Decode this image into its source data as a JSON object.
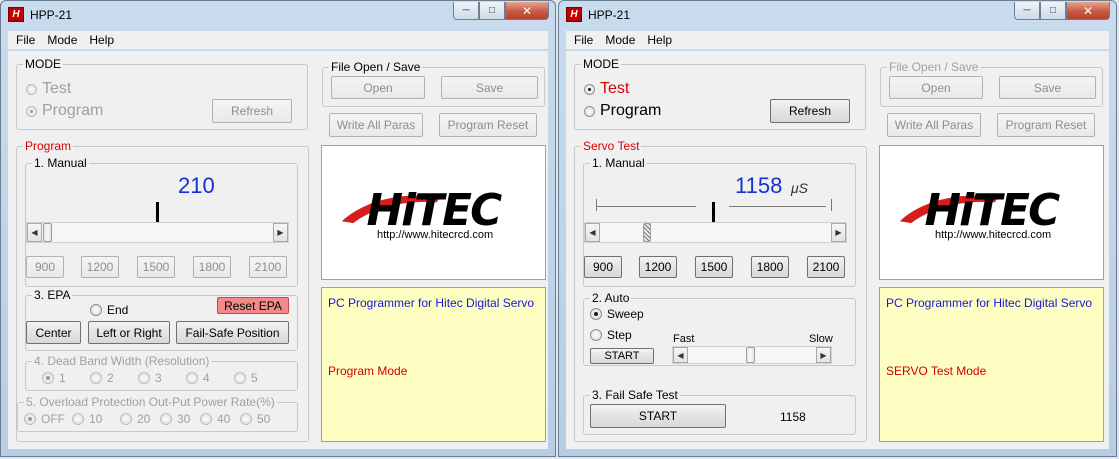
{
  "colors": {
    "accent_red": "#e00000",
    "value_blue": "#1530d8",
    "info_bg": "#fffec2",
    "reset_epa_bg": "#f28a8a"
  },
  "icons": {
    "app": "hitec-app-icon",
    "minimize": "minimize-icon",
    "maximize": "maximize-icon",
    "close": "close-icon"
  },
  "left": {
    "title": "HPP-21",
    "app_icon_text": "H",
    "controls": {
      "minimize": "─",
      "maximize": "□",
      "close": "✕"
    },
    "menu": [
      "File",
      "Mode",
      "Help"
    ],
    "mode": {
      "label": "MODE",
      "test": "Test",
      "program": "Program",
      "selected": "program",
      "refresh": "Refresh"
    },
    "file": {
      "label": "File Open / Save",
      "open": "Open",
      "save": "Save",
      "write_all": "Write All Paras",
      "program_reset": "Program Reset"
    },
    "program": {
      "label": "Program",
      "manual": {
        "label": "1. Manual",
        "value": "210",
        "presets": [
          "900",
          "1200",
          "1500",
          "1800",
          "2100"
        ]
      },
      "epa": {
        "label": "3. EPA",
        "end": "End",
        "reset_epa": "Reset EPA",
        "center": "Center",
        "left_right": "Left or Right",
        "failsafe": "Fail-Safe Position"
      },
      "deadband": {
        "label": "4. Dead Band Width (Resolution)",
        "options": [
          "1",
          "2",
          "3",
          "4",
          "5"
        ],
        "selected": "1"
      },
      "overload": {
        "label": "5. Overload Protection Out-Put Power Rate(%)",
        "options": [
          "OFF",
          "10",
          "20",
          "30",
          "40",
          "50"
        ],
        "selected": "OFF"
      }
    },
    "logo_url": "http://www.hitecrcd.com",
    "info": {
      "title": "PC Programmer for Hitec Digital Servo",
      "mode_text": "Program Mode"
    }
  },
  "right": {
    "title": "HPP-21",
    "app_icon_text": "H",
    "controls": {
      "minimize": "─",
      "maximize": "□",
      "close": "✕"
    },
    "menu": [
      "File",
      "Mode",
      "Help"
    ],
    "mode": {
      "label": "MODE",
      "test": "Test",
      "program": "Program",
      "selected": "test",
      "refresh": "Refresh"
    },
    "file": {
      "label": "File Open / Save",
      "open": "Open",
      "save": "Save",
      "write_all": "Write All Paras",
      "program_reset": "Program Reset"
    },
    "servo": {
      "label": "Servo Test",
      "manual": {
        "label": "1. Manual",
        "value": "1158",
        "unit": "μS",
        "presets": [
          "900",
          "1200",
          "1500",
          "1800",
          "2100"
        ]
      },
      "auto": {
        "label": "2. Auto",
        "sweep": "Sweep",
        "step": "Step",
        "selected": "sweep",
        "start": "START",
        "fast": "Fast",
        "slow": "Slow"
      },
      "failsafe": {
        "label": "3. Fail Safe Test",
        "start": "START",
        "value": "1158"
      }
    },
    "logo_url": "http://www.hitecrcd.com",
    "info": {
      "title": "PC Programmer for Hitec Digital Servo",
      "mode_text": "SERVO Test Mode"
    }
  }
}
